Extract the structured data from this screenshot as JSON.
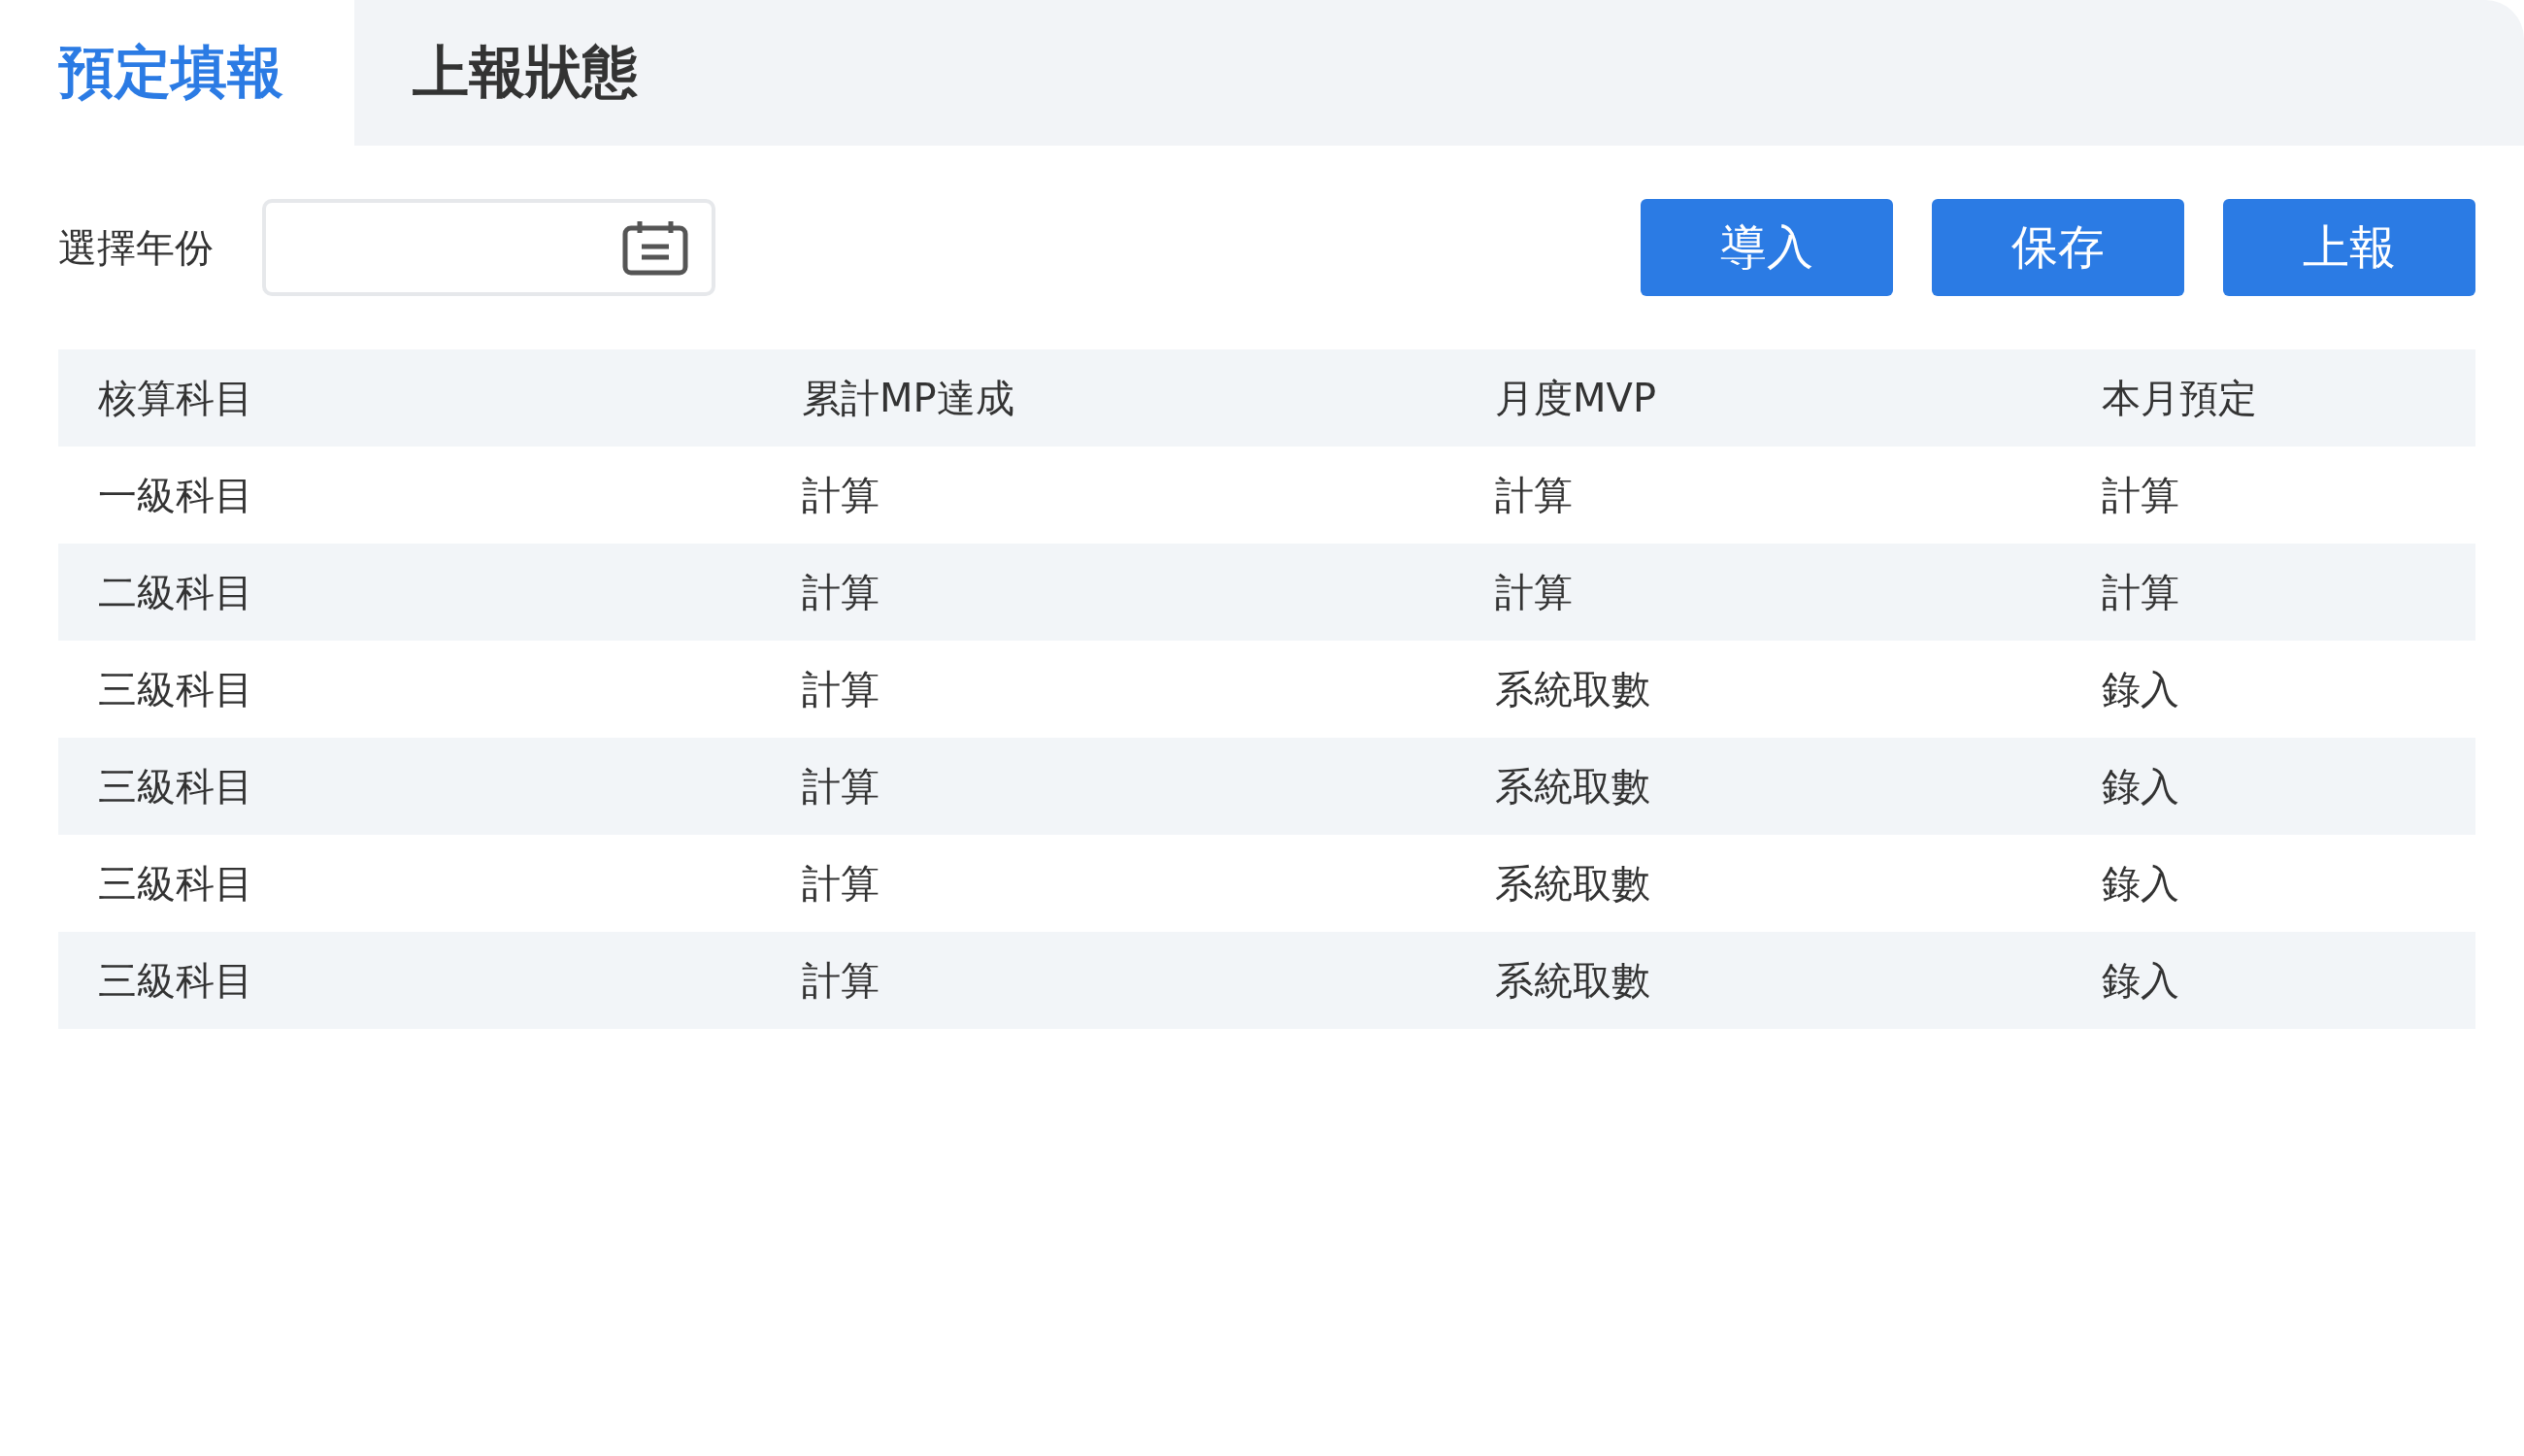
{
  "tabs": [
    {
      "label": "預定填報",
      "selected": true
    },
    {
      "label": "上報狀態",
      "selected": false
    }
  ],
  "year_picker": {
    "label": "選擇年份"
  },
  "buttons": [
    "導入",
    "保存",
    "上報"
  ],
  "table": {
    "columns": [
      "核算科目",
      "累計MP達成",
      "月度MVP",
      "本月預定"
    ],
    "rows": [
      [
        "一級科目",
        "計算",
        "計算",
        "計算"
      ],
      [
        "二級科目",
        "計算",
        "計算",
        "計算"
      ],
      [
        "三級科目",
        "計算",
        "系統取數",
        "錄入"
      ],
      [
        "三級科目",
        "計算",
        "系統取數",
        "錄入"
      ],
      [
        "三級科目",
        "計算",
        "系統取數",
        "錄入"
      ],
      [
        "三級科目",
        "計算",
        "系統取數",
        "錄入"
      ]
    ]
  }
}
